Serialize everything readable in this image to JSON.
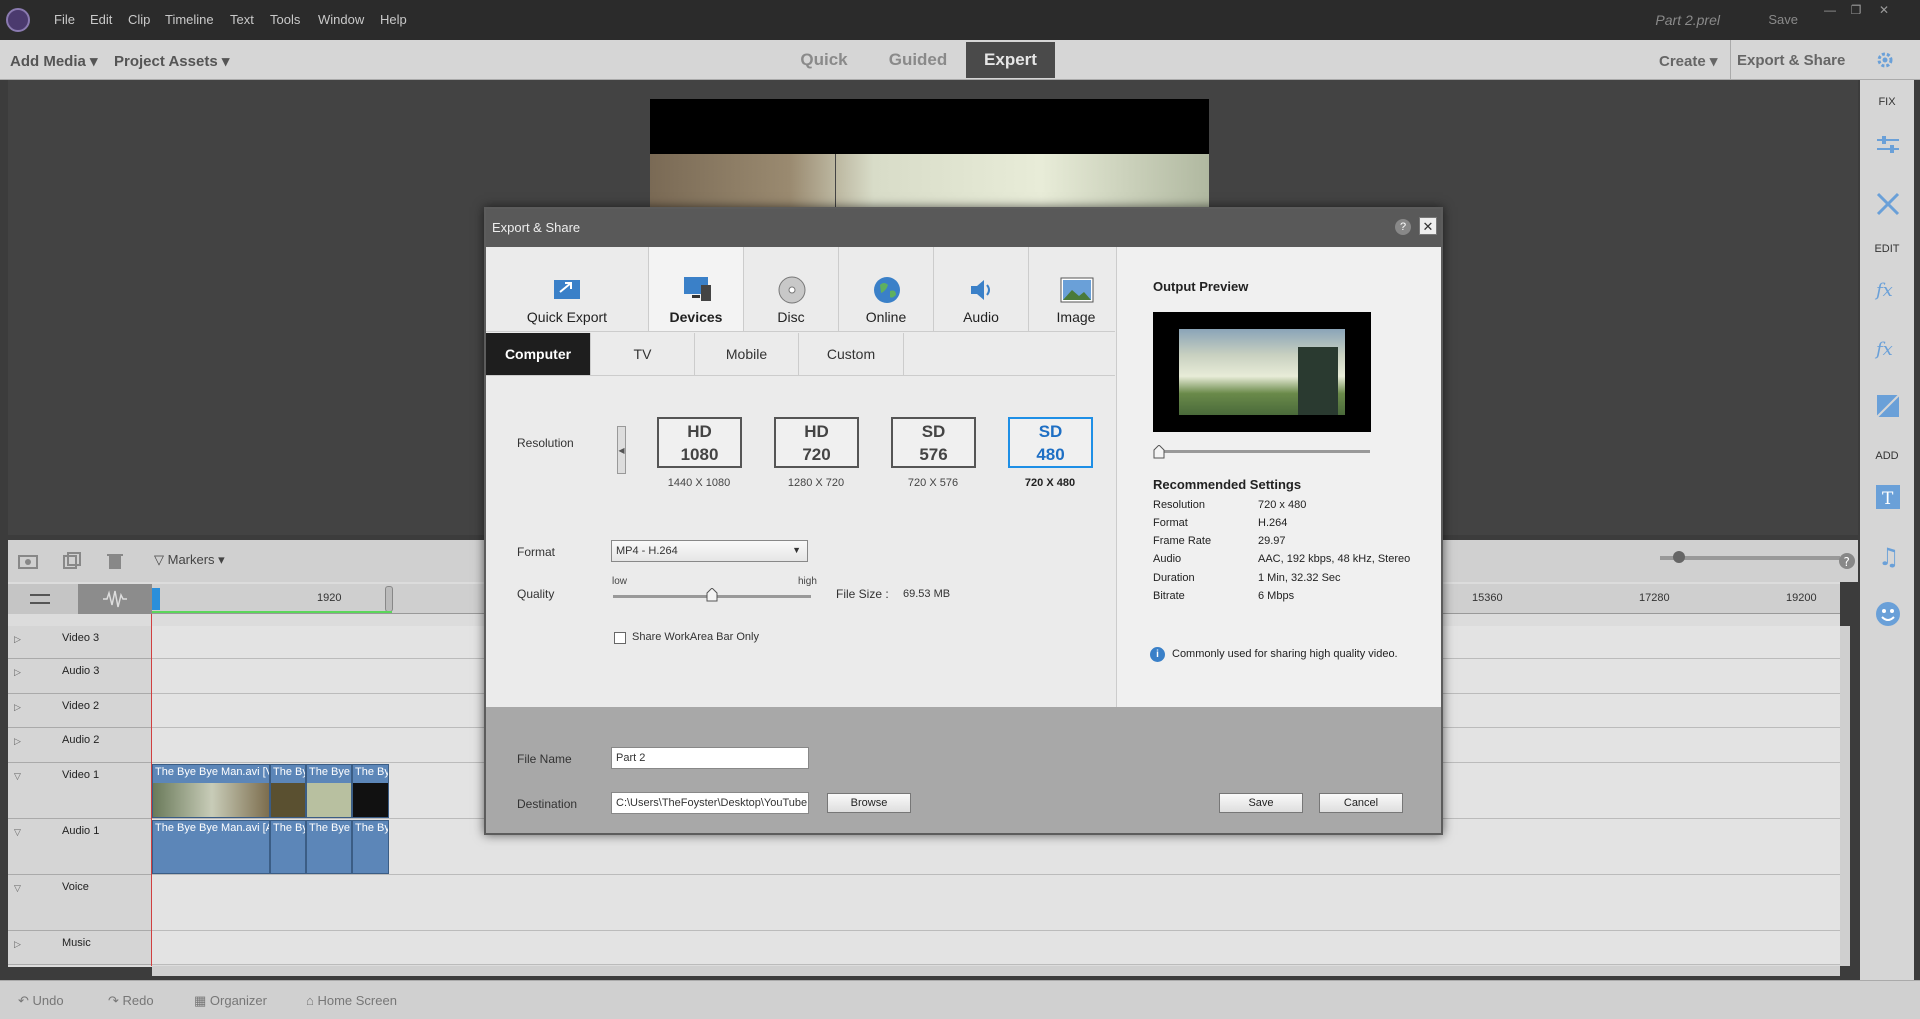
{
  "menu": [
    "File",
    "Edit",
    "Clip",
    "Timeline",
    "Text",
    "Tools",
    "Window",
    "Help"
  ],
  "project_title": "Part 2.prel",
  "top_save": "Save",
  "window_controls": {
    "minimize": "—",
    "restore": "❐",
    "close": "✕"
  },
  "modebar": {
    "add_media": "Add Media",
    "project_assets": "Project Assets",
    "modes": [
      "Quick",
      "Guided",
      "Expert"
    ],
    "active_mode": "Expert",
    "create": "Create",
    "export_share": "Export & Share"
  },
  "right_panel": {
    "fix": "FIX",
    "edit": "EDIT",
    "add": "ADD"
  },
  "timeline": {
    "markers": "Markers",
    "ruler_ticks": [
      "1920",
      "15360",
      "17280",
      "19200"
    ],
    "tracks": [
      "Video 3",
      "Audio 3",
      "Video 2",
      "Audio 2",
      "Video 1",
      "Audio 1",
      "Voice",
      "Music"
    ],
    "clip_labels": [
      "The Bye Bye Man.avi [V",
      "The By",
      "The Bye",
      "The By"
    ],
    "audio_clip_labels": [
      "The Bye Bye Man.avi [A",
      "The By",
      "The Bye",
      "The By"
    ]
  },
  "statusbar": {
    "undo": "Undo",
    "redo": "Redo",
    "organizer": "Organizer",
    "home": "Home Screen"
  },
  "dialog": {
    "title": "Export & Share",
    "help": "?",
    "categories": [
      "Quick Export",
      "Devices",
      "Disc",
      "Online",
      "Audio",
      "Image"
    ],
    "active_category": "Devices",
    "subtabs": [
      "Computer",
      "TV",
      "Mobile",
      "Custom"
    ],
    "active_subtab": "Computer",
    "resolution_label": "Resolution",
    "resolutions": [
      {
        "l1": "HD",
        "l2": "1080",
        "dims": "1440 X 1080"
      },
      {
        "l1": "HD",
        "l2": "720",
        "dims": "1280 X 720"
      },
      {
        "l1": "SD",
        "l2": "576",
        "dims": "720 X 576"
      },
      {
        "l1": "SD",
        "l2": "480",
        "dims": "720 X 480"
      }
    ],
    "active_resolution": "SD 480",
    "format_label": "Format",
    "format_value": "MP4 - H.264",
    "quality_label": "Quality",
    "quality_low": "low",
    "quality_high": "high",
    "quality_level": 0.5,
    "file_size_label": "File Size :",
    "file_size_value": "69.53 MB",
    "workarea_label": "Share WorkArea Bar Only",
    "workarea_checked": false,
    "file_name_label": "File Name",
    "file_name_value": "Part 2",
    "destination_label": "Destination",
    "destination_value": "C:\\Users\\TheFoyster\\Desktop\\YouTube",
    "browse": "Browse",
    "save": "Save",
    "cancel": "Cancel",
    "output_preview_title": "Output Preview",
    "recommended_title": "Recommended Settings",
    "settings": [
      {
        "k": "Resolution",
        "v": "720 x 480"
      },
      {
        "k": "Format",
        "v": "H.264"
      },
      {
        "k": "Frame Rate",
        "v": "29.97"
      },
      {
        "k": "Audio",
        "v": "AAC, 192 kbps, 48 kHz, Stereo"
      },
      {
        "k": "Duration",
        "v": "1 Min, 32.32 Sec"
      },
      {
        "k": "Bitrate",
        "v": "6 Mbps"
      }
    ],
    "info_text": "Commonly used for sharing high quality video."
  },
  "colors": {
    "accent": "#1e8fe6",
    "dialog_title": "#595959",
    "clip": "#5c86b8"
  }
}
